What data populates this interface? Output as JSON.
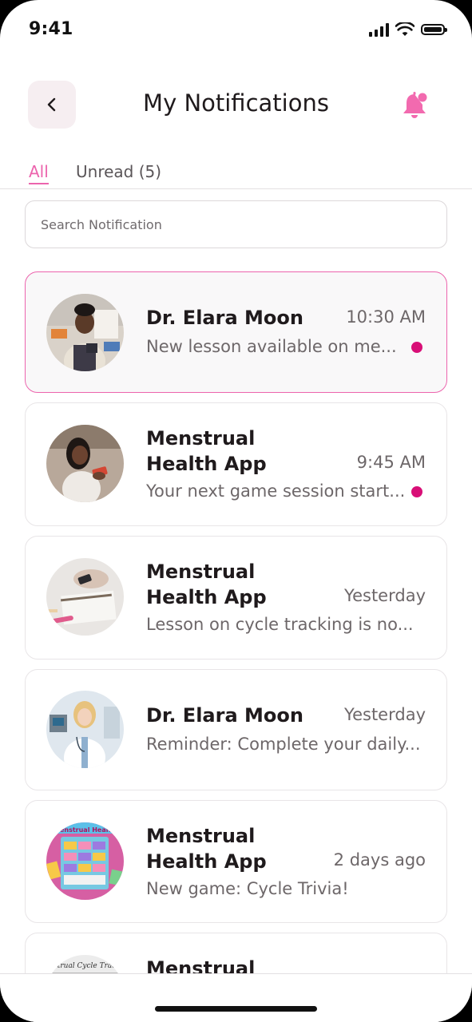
{
  "status_bar": {
    "time": "9:41"
  },
  "header": {
    "title": "My Notifications"
  },
  "tabs": [
    {
      "label": "All"
    },
    {
      "label": "Unread (5)"
    }
  ],
  "search": {
    "placeholder": "Search Notification",
    "value": ""
  },
  "notifications": [
    {
      "sender": "Dr. Elara Moon",
      "time": "10:30 AM",
      "message": "New lesson available on me...",
      "unread": true,
      "avatar_icon": "teacher-photo"
    },
    {
      "sender": "Menstrual Health App",
      "time": "9:45 AM",
      "message": "Your next game session start...",
      "unread": true,
      "avatar_icon": "phone-gaming-photo"
    },
    {
      "sender": "Menstrual Health App",
      "time": "Yesterday",
      "message": "Lesson on cycle tracking is no...",
      "unread": false,
      "avatar_icon": "notebook-phone-photo"
    },
    {
      "sender": "Dr. Elara Moon",
      "time": "Yesterday",
      "message": "Reminder: Complete your daily...",
      "unread": false,
      "avatar_icon": "doctor-photo"
    },
    {
      "sender": "Menstrual Health App",
      "time": "2 days ago",
      "message": "New game: Cycle Trivia!",
      "unread": false,
      "avatar_icon": "game-board-photo",
      "avatar_text": "Menstrual Health"
    },
    {
      "sender": "Menstrual Health",
      "time": "",
      "message": "",
      "unread": false,
      "avatar_icon": "cycle-tracking-photo",
      "avatar_text": "Menstrual Cycle Tracking"
    }
  ],
  "colors": {
    "accent": "#ec64ad",
    "unread_dot": "#d80f77"
  }
}
